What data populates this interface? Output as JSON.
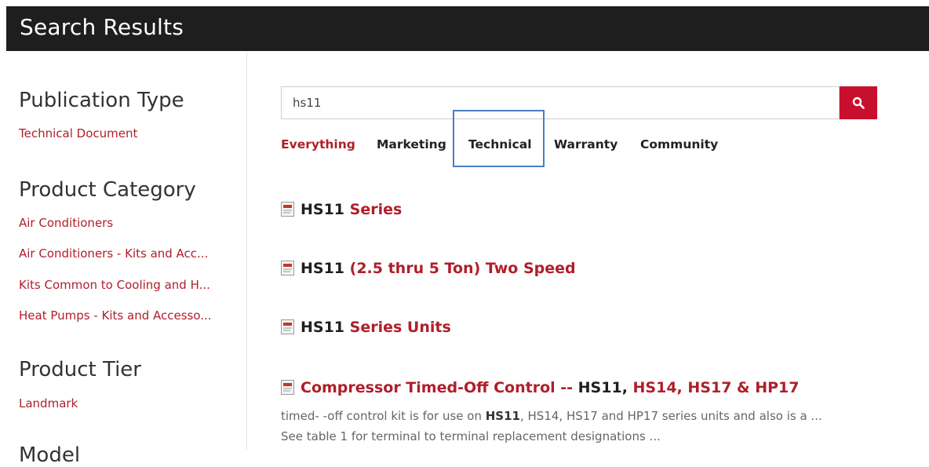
{
  "header": {
    "title": "Search Results"
  },
  "sidebar": {
    "facets": [
      {
        "title": "Publication Type",
        "links": [
          "Technical Document"
        ]
      },
      {
        "title": "Product Category",
        "links": [
          "Air Conditioners",
          "Air Conditioners - Kits and Acc...",
          "Kits Common to Cooling and H...",
          "Heat Pumps - Kits and Accesso..."
        ]
      },
      {
        "title": "Product Tier",
        "links": [
          "Landmark"
        ]
      }
    ],
    "cut_title": "Model"
  },
  "search": {
    "value": "hs11",
    "button_icon": "search-icon"
  },
  "tabs": [
    "Everything",
    "Marketing",
    "Technical",
    "Warranty",
    "Community"
  ],
  "results": [
    {
      "parts": [
        "HS11",
        " Series"
      ]
    },
    {
      "parts": [
        "HS11",
        " (2.5 thru 5 Ton) Two Speed"
      ]
    },
    {
      "parts": [
        "HS11",
        " Series Units"
      ]
    },
    {
      "parts": [
        "Compressor Timed-Off Control -- ",
        "HS11",
        ", ",
        "HS14, HS17 & HP17"
      ]
    }
  ],
  "snippet": {
    "before": "timed- -off control kit is for use on ",
    "bold": "HS11",
    "after": ", HS14, HS17 and HP17 series units and also is a ... See table 1 for terminal to terminal replacement designations ..."
  },
  "colors": {
    "brand_red": "#c8102e",
    "link_red": "#b01e2a",
    "header_bg": "#1e1e1e",
    "highlight": "#4a7ec2"
  }
}
